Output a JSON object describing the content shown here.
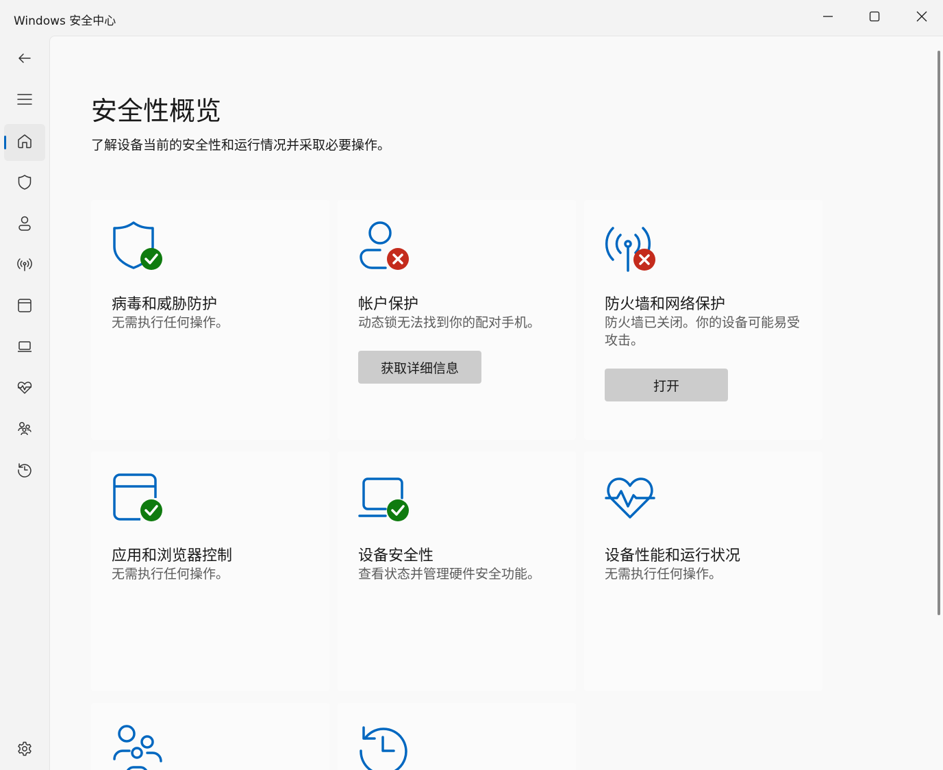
{
  "window": {
    "title": "Windows 安全中心",
    "controls": [
      "minimize-icon",
      "maximize-icon",
      "close-icon"
    ]
  },
  "sidebar": {
    "items": [
      {
        "name": "back",
        "icon": "back-arrow-icon",
        "active": false
      },
      {
        "name": "menu",
        "icon": "hamburger-menu-icon",
        "active": false
      },
      {
        "name": "home",
        "icon": "home-icon",
        "active": true
      },
      {
        "name": "virus-protection",
        "icon": "shield-icon",
        "active": false
      },
      {
        "name": "account-protection",
        "icon": "person-icon",
        "active": false
      },
      {
        "name": "firewall",
        "icon": "antenna-icon",
        "active": false
      },
      {
        "name": "app-browser",
        "icon": "browser-window-icon",
        "active": false
      },
      {
        "name": "device-security",
        "icon": "laptop-icon",
        "active": false
      },
      {
        "name": "device-performance",
        "icon": "heart-pulse-icon",
        "active": false
      },
      {
        "name": "family",
        "icon": "family-icon",
        "active": false
      },
      {
        "name": "history",
        "icon": "history-icon",
        "active": false
      },
      {
        "name": "settings",
        "icon": "gear-icon",
        "active": false
      }
    ]
  },
  "main": {
    "title": "安全性概览",
    "subtitle": "了解设备当前的安全性和运行情况并采取必要操作。",
    "cards": [
      {
        "title": "病毒和威胁防护",
        "desc": "无需执行任何操作。",
        "icon": "shield-icon",
        "status": "ok",
        "button": ""
      },
      {
        "title": "帐户保护",
        "desc": "动态锁无法找到你的配对手机。",
        "icon": "person-icon",
        "status": "error",
        "button": "获取详细信息"
      },
      {
        "title": "防火墙和网络保护",
        "desc": "防火墙已关闭。你的设备可能易受攻击。",
        "icon": "antenna-icon",
        "status": "error",
        "button": "打开"
      },
      {
        "title": "应用和浏览器控制",
        "desc": "无需执行任何操作。",
        "icon": "browser-window-icon",
        "status": "ok",
        "button": ""
      },
      {
        "title": "设备安全性",
        "desc": "查看状态并管理硬件安全功能。",
        "icon": "laptop-icon",
        "status": "ok",
        "button": ""
      },
      {
        "title": "设备性能和运行状况",
        "desc": "无需执行任何操作。",
        "icon": "heart-pulse-icon",
        "status": "none",
        "button": ""
      },
      {
        "title": "",
        "desc": "",
        "icon": "family-icon",
        "status": "none",
        "button": ""
      },
      {
        "title": "",
        "desc": "",
        "icon": "history-icon",
        "status": "none",
        "button": ""
      }
    ]
  },
  "colors": {
    "accent": "#0067c0",
    "ok": "#0f7b0f",
    "error": "#c42b1c",
    "button_bg": "#cccccc"
  }
}
